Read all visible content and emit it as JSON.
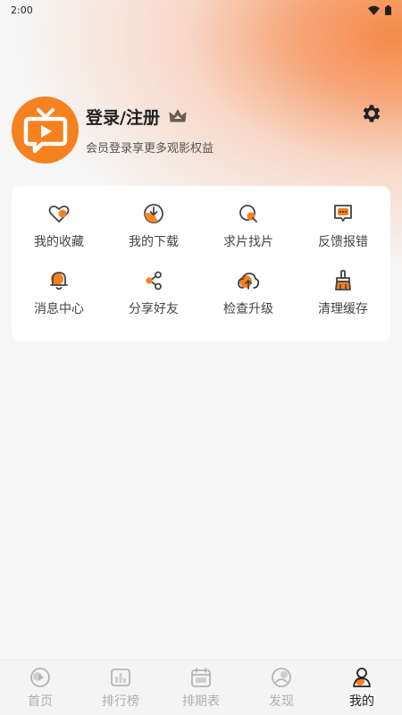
{
  "status": {
    "time": "2:00"
  },
  "profile": {
    "login_label": "登录/注册",
    "subtitle": "会员登录享更多观影权益"
  },
  "colors": {
    "accent": "#f6811f",
    "gray_icon": "#444444"
  },
  "menu": [
    {
      "label": "我的收藏",
      "icon": "heart-icon"
    },
    {
      "label": "我的下载",
      "icon": "download-icon"
    },
    {
      "label": "求片找片",
      "icon": "search-film-icon"
    },
    {
      "label": "反馈报错",
      "icon": "feedback-icon"
    },
    {
      "label": "消息中心",
      "icon": "bell-icon"
    },
    {
      "label": "分享好友",
      "icon": "share-icon"
    },
    {
      "label": "检查升级",
      "icon": "upgrade-icon"
    },
    {
      "label": "清理缓存",
      "icon": "broom-icon"
    }
  ],
  "nav": [
    {
      "label": "首页",
      "icon": "home-icon"
    },
    {
      "label": "排行榜",
      "icon": "ranking-icon"
    },
    {
      "label": "排期表",
      "icon": "calendar-icon"
    },
    {
      "label": "发现",
      "icon": "discover-icon"
    },
    {
      "label": "我的",
      "icon": "profile-icon",
      "active": true
    }
  ]
}
